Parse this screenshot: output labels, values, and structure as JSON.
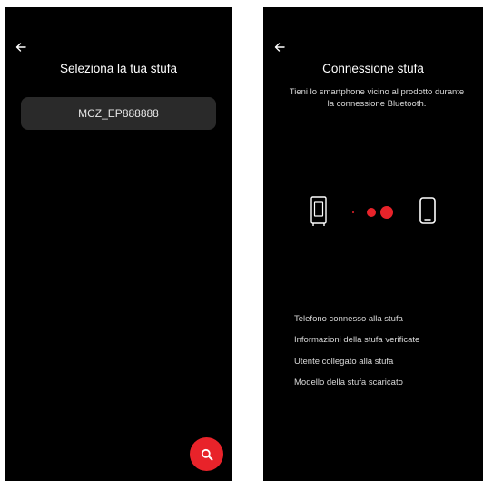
{
  "screen_select": {
    "title": "Seleziona la tua stufa",
    "devices": [
      "MCZ_EP888888"
    ],
    "back_icon": "arrow-left-icon",
    "search_icon": "search-icon"
  },
  "screen_connect": {
    "title": "Connessione stufa",
    "subtitle_line1": "Tieni lo smartphone vicino al prodotto durante",
    "subtitle_line2": "la connessione Bluetooth.",
    "back_icon": "arrow-left-icon",
    "steps": [
      "Telefono connesso alla stufa",
      "Informazioni della stufa verificate",
      "Utente collegato alla stufa",
      "Modello della stufa scaricato"
    ]
  },
  "colors": {
    "background": "#000000",
    "accent": "#e8232a",
    "card": "#2a2a2a",
    "text": "#ffffff"
  }
}
